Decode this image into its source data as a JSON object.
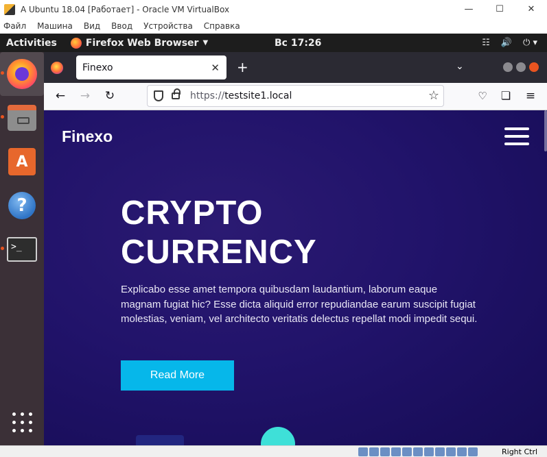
{
  "vbox": {
    "title": "A Ubuntu 18.04 [Работает] - Oracle VM VirtualBox",
    "menu": [
      "Файл",
      "Машина",
      "Вид",
      "Ввод",
      "Устройства",
      "Справка"
    ],
    "host_key": "Right Ctrl"
  },
  "gnome": {
    "activities": "Activities",
    "app_name": "Firefox Web Browser",
    "clock": "Вс 17:26"
  },
  "dock": {
    "apps": [
      "firefox-icon",
      "files-icon",
      "software-store-icon",
      "help-icon",
      "terminal-icon"
    ],
    "show_apps": "show-applications-icon"
  },
  "browser": {
    "tab_title": "Finexo",
    "url_scheme": "https://",
    "url_host": "testsite1.local"
  },
  "page": {
    "brand": "Finexo",
    "hero_title_line1": "CRYPTO",
    "hero_title_line2": "CURRENCY",
    "hero_text": "Explicabo esse amet tempora quibusdam laudantium, laborum eaque magnam fugiat hic? Esse dicta aliquid error repudiandae earum suscipit fugiat molestias, veniam, vel architecto veritatis delectus repellat modi impedit sequi.",
    "cta": "Read More"
  },
  "colors": {
    "hero_bg": "#21136a",
    "cta_bg": "#06b7ea",
    "dock_bg": "#3b3037",
    "accent": "#e95420"
  }
}
